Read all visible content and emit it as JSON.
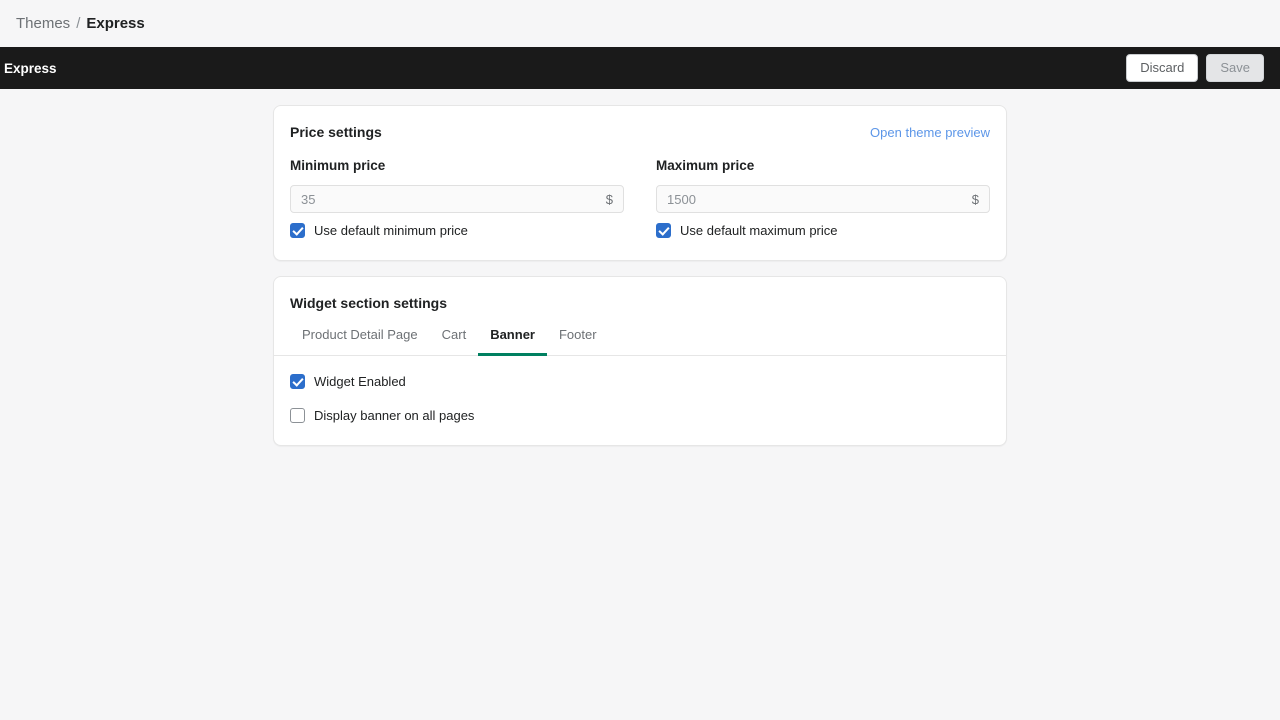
{
  "breadcrumb": {
    "root": "Themes",
    "separator": "/",
    "current": "Express"
  },
  "context_bar": {
    "title": "Express",
    "discard_label": "Discard",
    "save_label": "Save"
  },
  "price_card": {
    "title": "Price settings",
    "preview_link": "Open theme preview",
    "min": {
      "label": "Minimum price",
      "value": "",
      "placeholder": "35",
      "suffix": "$",
      "checkbox_label": "Use default minimum price",
      "checked": true
    },
    "max": {
      "label": "Maximum price",
      "value": "",
      "placeholder": "1500",
      "suffix": "$",
      "checkbox_label": "Use default maximum price",
      "checked": true
    }
  },
  "widget_card": {
    "title": "Widget section settings",
    "tabs": [
      {
        "label": "Product Detail Page",
        "active": false
      },
      {
        "label": "Cart",
        "active": false
      },
      {
        "label": "Banner",
        "active": true
      },
      {
        "label": "Footer",
        "active": false
      }
    ],
    "options": [
      {
        "label": "Widget Enabled",
        "checked": true
      },
      {
        "label": "Display banner on all pages",
        "checked": false
      }
    ]
  },
  "colors": {
    "accent_green": "#008060",
    "checkbox_blue": "#2c6ecb",
    "link_blue": "#5c96e8",
    "context_bar": "#1a1a1a",
    "page_bg": "#f6f6f7"
  }
}
